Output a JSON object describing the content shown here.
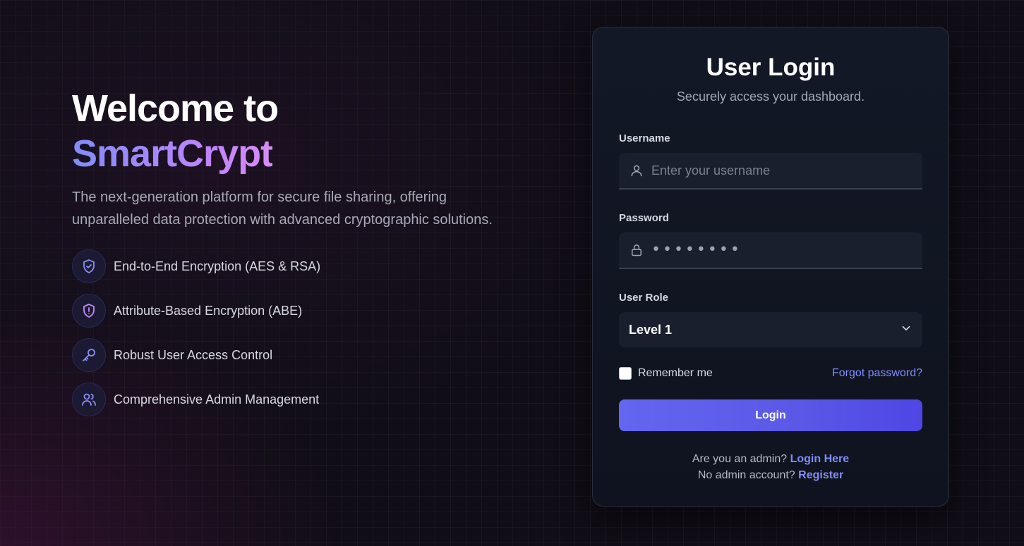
{
  "hero": {
    "title_line1": "Welcome to",
    "title_brand": "SmartCrypt",
    "description": "The next-generation platform for secure file sharing, offering unparalleled data protection with advanced cryptographic solutions.",
    "features": [
      {
        "icon": "shield-check-icon",
        "label": "End-to-End Encryption (AES & RSA)"
      },
      {
        "icon": "shield-alert-icon",
        "label": "Attribute-Based Encryption (ABE)"
      },
      {
        "icon": "key-icon",
        "label": "Robust User Access Control"
      },
      {
        "icon": "users-icon",
        "label": "Comprehensive Admin Management"
      }
    ]
  },
  "login": {
    "title": "User Login",
    "subtitle": "Securely access your dashboard.",
    "username": {
      "label": "Username",
      "placeholder": "Enter your username",
      "value": ""
    },
    "password": {
      "label": "Password",
      "masked_value": "••••••••"
    },
    "role": {
      "label": "User Role",
      "selected": "Level 1"
    },
    "remember_label": "Remember me",
    "remember_checked": false,
    "forgot_label": "Forgot password?",
    "submit_label": "Login",
    "admin_prompt": "Are you an admin?",
    "admin_link": "Login Here",
    "register_prompt": "No admin account?",
    "register_link": "Register"
  },
  "colors": {
    "accent": "#6366f1",
    "link": "#818cf8",
    "background": "#100d16",
    "card": "#131826"
  }
}
